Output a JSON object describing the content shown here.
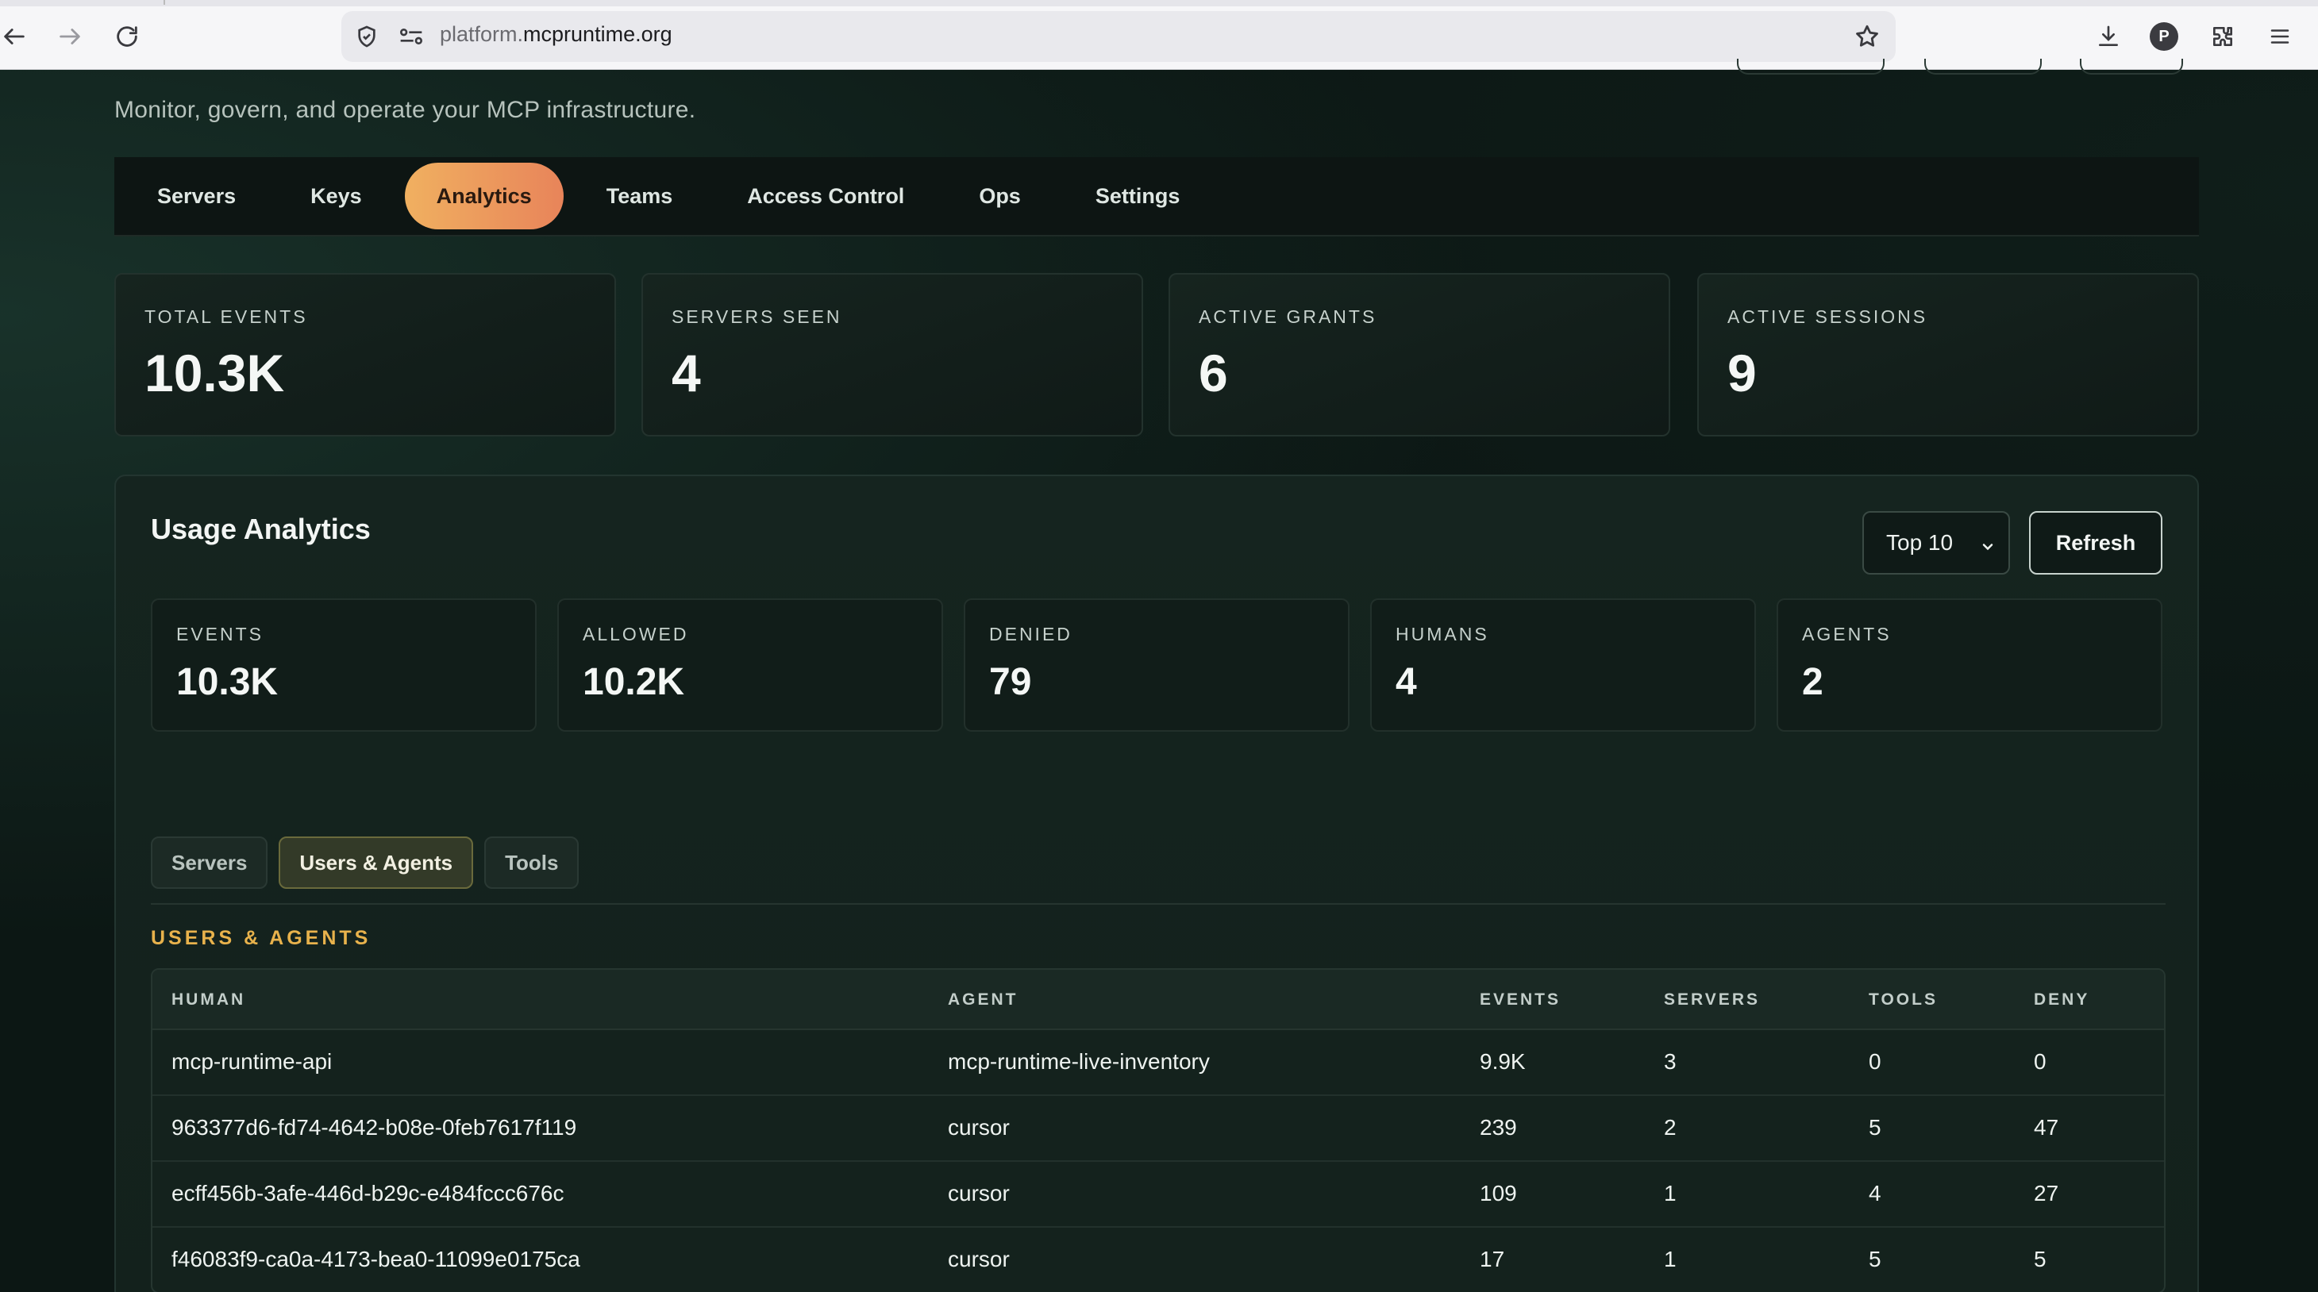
{
  "browser": {
    "url_domain": "platform.",
    "url_host": "mcpruntime.org",
    "profile_initial": "P"
  },
  "header": {
    "subtitle": "Monitor, govern, and operate your MCP infrastructure."
  },
  "nav_tabs": [
    {
      "label": "Servers",
      "active": false
    },
    {
      "label": "Keys",
      "active": false
    },
    {
      "label": "Analytics",
      "active": true
    },
    {
      "label": "Teams",
      "active": false
    },
    {
      "label": "Access Control",
      "active": false
    },
    {
      "label": "Ops",
      "active": false
    },
    {
      "label": "Settings",
      "active": false
    }
  ],
  "stats": [
    {
      "label": "TOTAL EVENTS",
      "value": "10.3K"
    },
    {
      "label": "SERVERS SEEN",
      "value": "4"
    },
    {
      "label": "ACTIVE GRANTS",
      "value": "6"
    },
    {
      "label": "ACTIVE SESSIONS",
      "value": "9"
    }
  ],
  "analytics": {
    "title": "Usage Analytics",
    "limit_select": "Top 10",
    "refresh_label": "Refresh",
    "summary": [
      {
        "label": "EVENTS",
        "value": "10.3K"
      },
      {
        "label": "ALLOWED",
        "value": "10.2K"
      },
      {
        "label": "DENIED",
        "value": "79"
      },
      {
        "label": "HUMANS",
        "value": "4"
      },
      {
        "label": "AGENTS",
        "value": "2"
      }
    ],
    "subtabs": [
      {
        "label": "Servers",
        "active": false
      },
      {
        "label": "Users & Agents",
        "active": true
      },
      {
        "label": "Tools",
        "active": false
      }
    ],
    "section_label": "USERS & AGENTS",
    "table": {
      "headers": [
        "HUMAN",
        "AGENT",
        "EVENTS",
        "SERVERS",
        "TOOLS",
        "DENY"
      ],
      "rows": [
        [
          "mcp-runtime-api",
          "mcp-runtime-live-inventory",
          "9.9K",
          "3",
          "0",
          "0"
        ],
        [
          "963377d6-fd74-4642-b08e-0feb7617f119",
          "cursor",
          "239",
          "2",
          "5",
          "47"
        ],
        [
          "ecff456b-3afe-446d-b29c-e484fccc676c",
          "cursor",
          "109",
          "1",
          "4",
          "27"
        ],
        [
          "f46083f9-ca0a-4173-bea0-11099e0175ca",
          "cursor",
          "17",
          "1",
          "5",
          "5"
        ]
      ]
    }
  }
}
